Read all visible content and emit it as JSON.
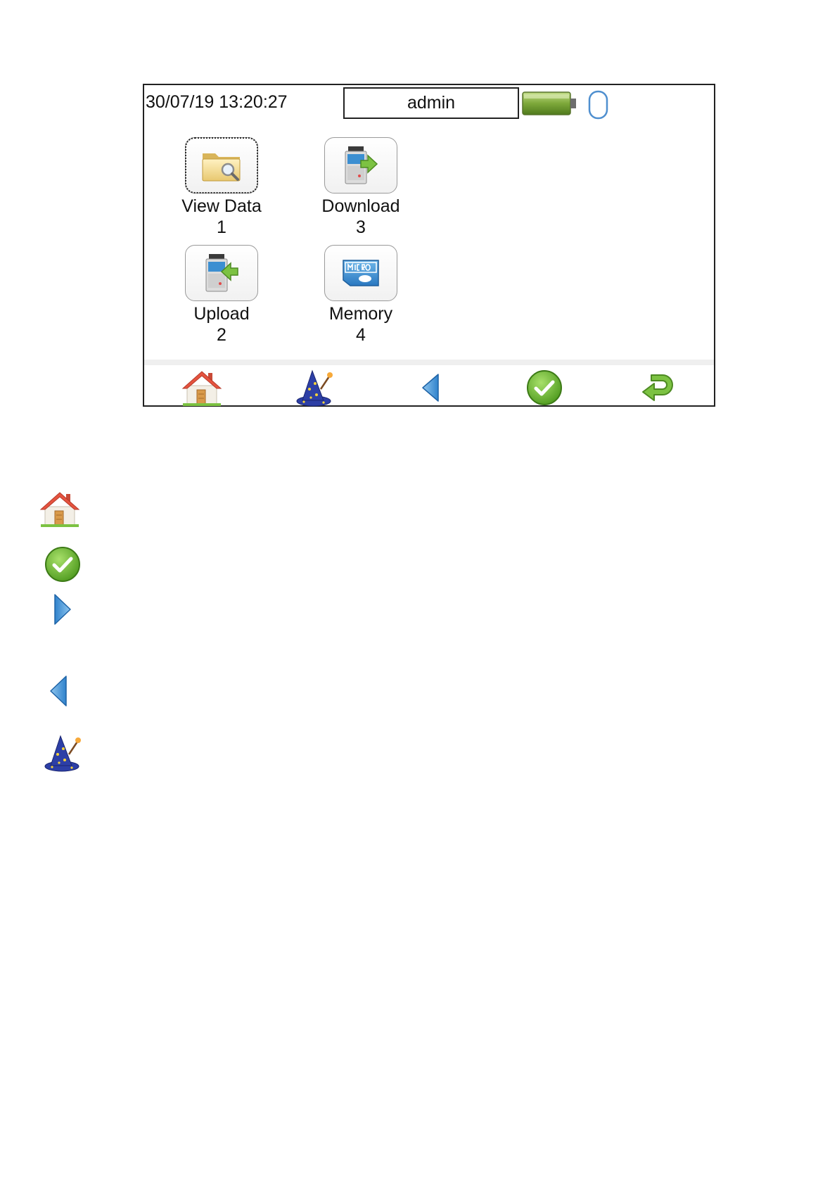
{
  "status_bar": {
    "datetime": "30/07/19 13:20:27",
    "user": "admin"
  },
  "menu": {
    "items": [
      {
        "label": "View Data",
        "number": "1",
        "icon": "folder-search-icon"
      },
      {
        "label": "Download",
        "number": "3",
        "icon": "device-download-icon"
      },
      {
        "label": "Upload",
        "number": "2",
        "icon": "device-upload-icon"
      },
      {
        "label": "Memory",
        "number": "4",
        "icon": "micro-sd-icon"
      }
    ]
  },
  "toolbar": {
    "buttons": [
      "home-icon",
      "wizard-hat-icon",
      "left-arrow-icon",
      "check-icon",
      "return-icon"
    ]
  },
  "legend": {
    "icons": [
      "home-icon",
      "check-icon",
      "right-arrow-icon",
      "left-arrow-icon",
      "wizard-hat-icon"
    ]
  },
  "colors": {
    "battery": "#7da83a",
    "check": "#6cb52d",
    "arrow": "#3b8fd6",
    "return": "#7cc242",
    "house_roof": "#e5533f",
    "wizard_hat": "#2d3fa6"
  }
}
